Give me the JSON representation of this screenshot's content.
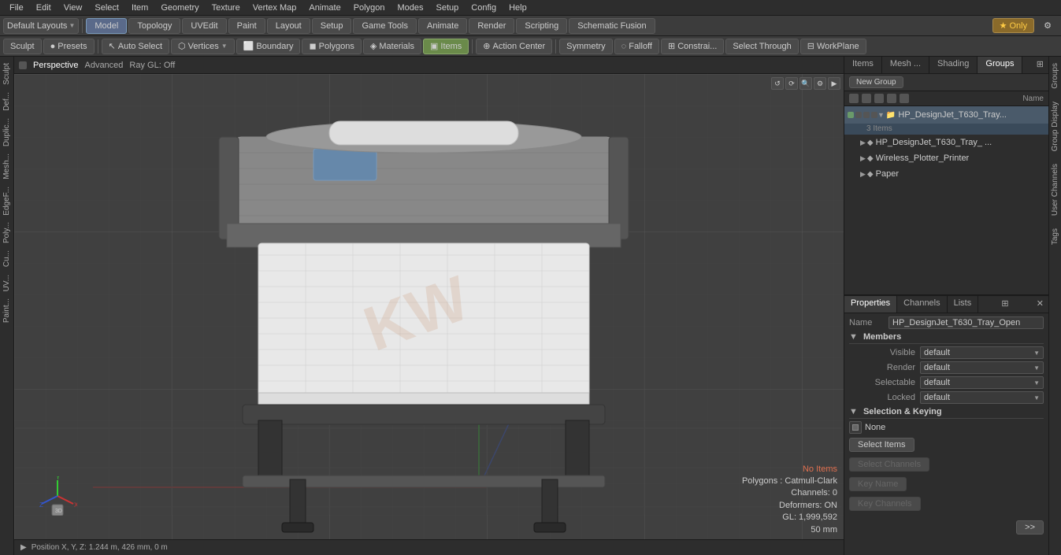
{
  "menubar": {
    "items": [
      "File",
      "Edit",
      "View",
      "Select",
      "Item",
      "Geometry",
      "Texture",
      "Vertex Map",
      "Animate",
      "Polygon",
      "Modes",
      "Setup",
      "Config",
      "Help"
    ]
  },
  "toolbar1": {
    "layout_dropdown": "Default Layouts",
    "tabs": [
      {
        "label": "Model",
        "active": true
      },
      {
        "label": "Topology",
        "active": false
      },
      {
        "label": "UVEdit",
        "active": false
      },
      {
        "label": "Paint",
        "active": false
      },
      {
        "label": "Layout",
        "active": false
      },
      {
        "label": "Setup",
        "active": false
      },
      {
        "label": "Game Tools",
        "active": false
      },
      {
        "label": "Animate",
        "active": false
      },
      {
        "label": "Render",
        "active": false
      },
      {
        "label": "Scripting",
        "active": false
      },
      {
        "label": "Schematic Fusion",
        "active": false
      }
    ],
    "star_label": "Only",
    "settings_icon": "⚙"
  },
  "toolbar2": {
    "sculpt": "Sculpt",
    "presets": "Presets",
    "auto_select": "Auto Select",
    "vertices": "Vertices",
    "boundary": "Boundary",
    "polygons": "Polygons",
    "materials": "Materials",
    "items": "Items",
    "action_center": "Action Center",
    "symmetry": "Symmetry",
    "falloff": "Falloff",
    "constraint": "Constrai...",
    "select_through": "Select Through",
    "workplane": "WorkPlane"
  },
  "viewport": {
    "dot_label": "Perspective",
    "advanced_label": "Advanced",
    "raygl_label": "Ray GL: Off",
    "icons": [
      "↺",
      "⟳",
      "🔍",
      "⚙",
      "▶"
    ],
    "info": {
      "no_items": "No Items",
      "polygons": "Polygons : Catmull-Clark",
      "channels": "Channels: 0",
      "deformers": "Deformers: ON",
      "gl": "GL: 1,999,592",
      "size": "50 mm"
    },
    "status": "Position X, Y, Z:  1.244 m, 426 mm, 0 m"
  },
  "left_sidebar": {
    "tabs": [
      "Sculpt",
      "Def...",
      "Duplic...",
      "Mesh...",
      "EdgeF...",
      "Poly...",
      "Cu...",
      "UV...",
      "Paint..."
    ]
  },
  "right_panel": {
    "top_tabs": [
      "Items",
      "Mesh ...",
      "Shading",
      "Groups"
    ],
    "new_group_btn": "New Group",
    "name_col": "Name",
    "tree": {
      "group_row": {
        "name": "HP_DesignJet_T630_Tray...",
        "count": "3 Items",
        "selected": true
      },
      "children": [
        {
          "label": "HP_DesignJet_T630_Tray_ ...",
          "indent": 1,
          "has_icon": true
        },
        {
          "label": "Wireless_Plotter_Printer",
          "indent": 1,
          "has_icon": true
        },
        {
          "label": "Paper",
          "indent": 1,
          "has_icon": true
        }
      ]
    },
    "props_tabs": [
      "Properties",
      "Channels",
      "Lists"
    ],
    "props": {
      "name_label": "Name",
      "name_value": "HP_DesignJet_T630_Tray_Open",
      "members_section": "Members",
      "visible_label": "Visible",
      "visible_value": "default",
      "render_label": "Render",
      "render_value": "default",
      "selectable_label": "Selectable",
      "selectable_value": "default",
      "locked_label": "Locked",
      "locked_value": "default",
      "sel_keying_section": "Selection & Keying",
      "sel_none_label": "None",
      "select_items_btn": "Select Items",
      "select_channels_btn": "Select Channels",
      "key_name_btn": "Key Name",
      "key_channels_btn": "Key Channels",
      "arrow_btn": ">>"
    }
  },
  "right_strip": {
    "tabs": [
      "Groups",
      "Group Display",
      "User Channels",
      "Tags"
    ]
  }
}
